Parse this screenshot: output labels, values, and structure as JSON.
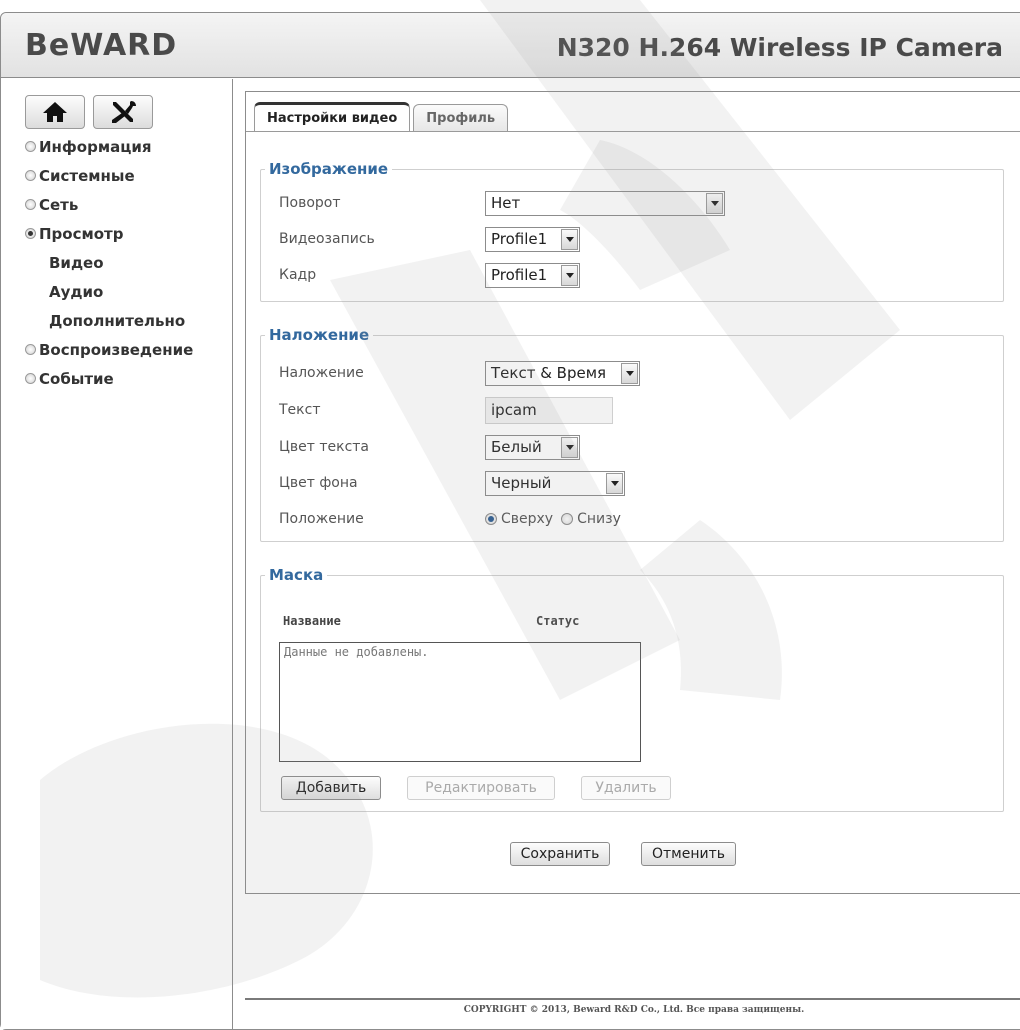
{
  "header": {
    "logo": "BeWARD",
    "camera_title": "N320 H.264 Wireless IP Camera"
  },
  "sidebar": {
    "home_icon": "home-icon",
    "settings_icon": "tools-icon",
    "menu": [
      {
        "label": "Информация",
        "selected": false
      },
      {
        "label": "Системные",
        "selected": false
      },
      {
        "label": "Сеть",
        "selected": false
      },
      {
        "label": "Просмотр",
        "selected": true
      },
      {
        "label": "Видео"
      },
      {
        "label": "Аудио"
      },
      {
        "label": "Дополнительно"
      },
      {
        "label": "Воспроизведение",
        "selected": false
      },
      {
        "label": "Событие",
        "selected": false
      }
    ]
  },
  "tabs": {
    "video_settings": "Настройки видео",
    "profile": "Профиль"
  },
  "image_group": {
    "legend": "Изображение",
    "rotation_label": "Поворот",
    "rotation_value": "Нет",
    "recording_label": "Видеозапись",
    "recording_value": "Profile1",
    "frame_label": "Кадр",
    "frame_value": "Profile1"
  },
  "overlay_group": {
    "legend": "Наложение",
    "overlay_label": "Наложение",
    "overlay_value": "Текст & Время",
    "text_label": "Текст",
    "text_value": "ipcam",
    "text_color_label": "Цвет текста",
    "text_color_value": "Белый",
    "bg_color_label": "Цвет фона",
    "bg_color_value": "Черный",
    "position_label": "Положение",
    "position_top": "Сверху",
    "position_bottom": "Снизу",
    "position_selected": "top"
  },
  "mask_group": {
    "legend": "Маска",
    "col_name": "Название",
    "col_status": "Статус",
    "empty_text": "Данные не добавлены.",
    "add_button": "Добавить",
    "edit_button": "Редактировать",
    "delete_button": "Удалить"
  },
  "actions": {
    "save": "Сохранить",
    "cancel": "Отменить"
  },
  "footer": {
    "copyright": "COPYRIGHT © 2013, Beward R&D Co., Ltd. Все права защищены."
  },
  "colors": {
    "legend_blue": "#33699e",
    "radio_selected": "#2a5a90",
    "border": "#8c8c8c"
  }
}
